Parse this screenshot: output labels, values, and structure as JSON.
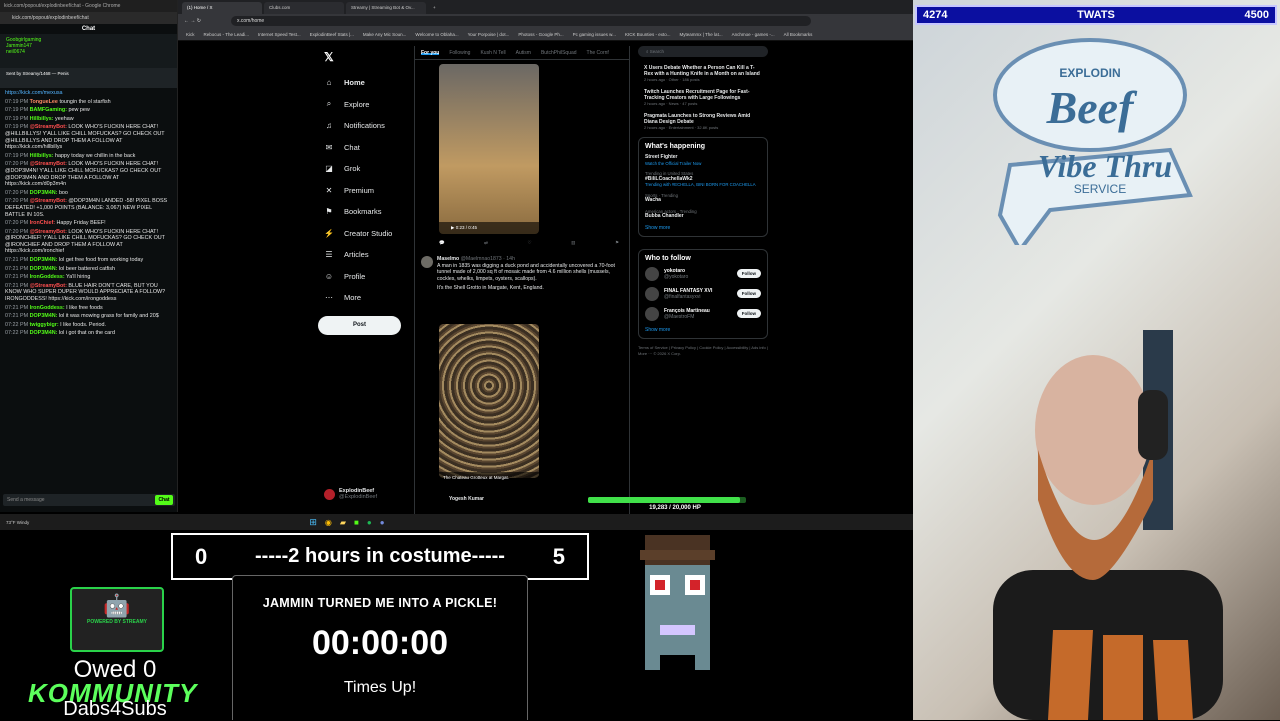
{
  "chat": {
    "window_title": "kick.com/popout/explodinbeef/chat - Google Chrome",
    "url": "kick.com/popout/explodinbeef/chat",
    "header": "Chat",
    "gifters": [
      "Goobgirlgaming",
      "Jammin147",
      "neil0674"
    ],
    "pinned": "Sent by Streamy/1468 — Penis",
    "messages": [
      {
        "time": "",
        "user": "",
        "color": "#53b4ff",
        "text": "https://kick.com/mexusa"
      },
      {
        "time": "07:19 PM",
        "user": "TongueLee",
        "color": "#ff8a65",
        "text": "toungin the ol starfish"
      },
      {
        "time": "07:19 PM",
        "user": "BAMFGaming:",
        "color": "#53fc18",
        "text": "pew pew"
      },
      {
        "time": "07:19 PM",
        "user": "Hillbillys:",
        "color": "#53fc18",
        "text": "yeehaw"
      },
      {
        "time": "07:19 PM",
        "user": "@StreamyBot:",
        "color": "#ff4f4f",
        "text": "LOOK WHO'S FUCKIN HERE CHAT! @HILLBILLYS! Y'ALL LIKE CHILL MOFUCKAS? GO CHECK OUT @HILLBILLYS AND DROP THEM A FOLLOW AT https://kick.com/hillbillys"
      },
      {
        "time": "07:19 PM",
        "user": "Hillbillys:",
        "color": "#53fc18",
        "text": "happy today we chillin in the back"
      },
      {
        "time": "07:20 PM",
        "user": "@StreamyBot:",
        "color": "#ff4f4f",
        "text": "LOOK WHO'S FUCKIN HERE CHAT! @DOP3M4N! Y'ALL LIKE CHILL MOFUCKAS? GO CHECK OUT @DOP3M4N AND DROP THEM A FOLLOW AT https://kick.com/d0p3m4n"
      },
      {
        "time": "07:20 PM",
        "user": "DOP3M4N:",
        "color": "#53fc18",
        "text": "boo"
      },
      {
        "time": "07:20 PM",
        "user": "@StreamyBot:",
        "color": "#ff4f4f",
        "text": "@DOP3M4N LANDED -58! PIXEL BOSS DEFEATED! +1,000 POINTS (BALANCE: 3,067) NEW PIXEL BATTLE IN 10S."
      },
      {
        "time": "07:20 PM",
        "user": "IronChief:",
        "color": "#ff4f4f",
        "text": "Happy Friday BEEF!"
      },
      {
        "time": "07:20 PM",
        "user": "@StreamyBot:",
        "color": "#ff4f4f",
        "text": "LOOK WHO'S FUCKIN HERE CHAT! @IRONCHIEF! Y'ALL LIKE CHILL MOFUCKAS? GO CHECK OUT @IRONCHIEF AND DROP THEM A FOLLOW AT https://kick.com/ironchief"
      },
      {
        "time": "07:21 PM",
        "user": "DOP3M4N:",
        "color": "#53fc18",
        "text": "lol get free food from working today"
      },
      {
        "time": "07:21 PM",
        "user": "DOP3M4N:",
        "color": "#53fc18",
        "text": "lol beer battered catfish"
      },
      {
        "time": "07:21 PM",
        "user": "IronGoddess:",
        "color": "#53fc18",
        "text": "Ya'll hiring"
      },
      {
        "time": "07:21 PM",
        "user": "@StreamyBot:",
        "color": "#ff4f4f",
        "text": "BLUE HAIR DON'T CARE, BUT YOU KNOW WHO SUPER DUPER WOULD APPRECIATE A FOLLOW? IRONGODDESS! https://kick.com/irongoddess"
      },
      {
        "time": "07:21 PM",
        "user": "IronGoddess:",
        "color": "#53fc18",
        "text": "I like free foods"
      },
      {
        "time": "07:21 PM",
        "user": "DOP3M4N:",
        "color": "#53fc18",
        "text": "lol it was mowing grass for family and 20$"
      },
      {
        "time": "07:22 PM",
        "user": "twiggybigr:",
        "color": "#53fc18",
        "text": "I like foods. Period."
      },
      {
        "time": "07:22 PM",
        "user": "DOP3M4N:",
        "color": "#53fc18",
        "text": "lol i got that on the card"
      }
    ],
    "send_placeholder": "Send a message",
    "send_label": "Chat"
  },
  "browser": {
    "tabs": [
      "(1) Home / X",
      "Clubs.com",
      "Streamy | Streaming Bot & Ov...",
      "+"
    ],
    "url": "x.com/home",
    "bookmarks": [
      "Kick",
      "Rebocus - The Leadi...",
      "Internet Speed Test...",
      "ExplodinBeef Stats |...",
      "Make Any Mic Soun...",
      "Welcome to Oblaha...",
      "Your Porpoise | dot...",
      "Photoss - Google Ph...",
      "Pc gaming issues w...",
      "KICK Bounties - exto...",
      "Myteammx | The lat...",
      "Anchmoe - games -...",
      "All Bookmarks"
    ]
  },
  "x": {
    "nav": [
      {
        "icon": "⌂",
        "label": "Home"
      },
      {
        "icon": "⌕",
        "label": "Explore"
      },
      {
        "icon": "♫",
        "label": "Notifications"
      },
      {
        "icon": "✉",
        "label": "Chat"
      },
      {
        "icon": "◪",
        "label": "Grok"
      },
      {
        "icon": "✕",
        "label": "Premium"
      },
      {
        "icon": "⚑",
        "label": "Bookmarks"
      },
      {
        "icon": "⚡",
        "label": "Creator Studio"
      },
      {
        "icon": "☰",
        "label": "Articles"
      },
      {
        "icon": "☺",
        "label": "Profile"
      },
      {
        "icon": "⋯",
        "label": "More"
      }
    ],
    "post_label": "Post",
    "account": "ExplodinBeef",
    "account_handle": "@ExplodinBeef",
    "feed_tabs": [
      "For you",
      "Following",
      "Kush N Tell",
      "Autism",
      "ButchPhilSquad",
      "The Cornf"
    ],
    "video_time": "0:23 / 0:45",
    "tweet": {
      "name": "Maselmo",
      "handle": "@Maelmnao1873 · 14h",
      "text": "A man in 1835 was digging a duck pond and accidentally uncovered a 70-foot tunnel made of 2,000 sq ft of mosaic made from 4.6 million shells (mussels, cockles, whelks, limpets, oysters, scallops).",
      "text2": "It's the Shell Grotto in Margate, Kent, England.",
      "caption": "The Chateau Grotteux at Margat.",
      "next_user": "Yogesh Kumar"
    },
    "search_placeholder": "Search",
    "news": [
      {
        "title": "X Users Debate Whether a Person Can Kill a T-Rex with a Hunting Knife in a Month on an Island",
        "meta": "2 hours ago · Other · 186 posts"
      },
      {
        "title": "Twitch Launches Recruitment Page for Fast-Tracking Creators with Large Followings",
        "meta": "2 hours ago · News · 47 posts"
      },
      {
        "title": "Pragmata Launches to Strong Reviews Amid Diana Design Debate",
        "meta": "2 hours ago · Entertainment · 32.8K posts"
      }
    ],
    "whats_happening": "What's happening",
    "trends": [
      {
        "meta": "",
        "name": "Street Fighter",
        "extra": "Watch the Official Trailer Now"
      },
      {
        "meta": "Trending in United States",
        "name": "#BiliLCoachellaWk2",
        "extra": "Trending with #ECHELLA, BINI BORN FOR COACHELLA"
      },
      {
        "meta": "Sports · Trending",
        "name": "Wacha",
        "extra": ""
      },
      {
        "meta": "American actors · Trending",
        "name": "Bubba Chandler",
        "extra": ""
      }
    ],
    "show_more": "Show more",
    "who_to_follow": "Who to follow",
    "suggestions": [
      {
        "name": "yokotaro",
        "handle": "@yokotaro",
        "btn": "Follow"
      },
      {
        "name": "FINAL FANTASY XVI",
        "handle": "@finalfantasyxvi",
        "btn": "Follow"
      },
      {
        "name": "François Martineau",
        "handle": "@MaestroFM",
        "btn": "Follow"
      }
    ],
    "footer": "Terms of Service | Privacy Policy | Cookie Policy | Accessibility | Ads info | More ··· © 2026 X Corp."
  },
  "hp": {
    "text": "19,283 / 20,000 HP",
    "fraction": 0.964
  },
  "taskbar": {
    "weather": "73°F Windy"
  },
  "overlay": {
    "counter_left": "4274",
    "counter_mid": "TWATS",
    "counter_right": "4500",
    "costume_left": "0",
    "costume_label": "-----2 hours in costume-----",
    "costume_right": "5",
    "timer_title": "JAMMIN TURNED ME INTO A PICKLE!",
    "timer_clock": "00:00:00",
    "timer_status": "Times Up!",
    "streamy": "POWERED BY STREAMY",
    "owed": "Owed 0",
    "kommunity": "KOMMUNITY",
    "dabs": "Dabs4Subs",
    "sign_line1": "EXPLODIN",
    "sign_line2": "Beef",
    "sign_line3": "Vibe Thru",
    "sign_line4": "SERVICE"
  },
  "colors": {
    "kick_green": "#53fc18",
    "x_blue": "#1d9bf0",
    "counter_bg": "#0b0fa0"
  }
}
